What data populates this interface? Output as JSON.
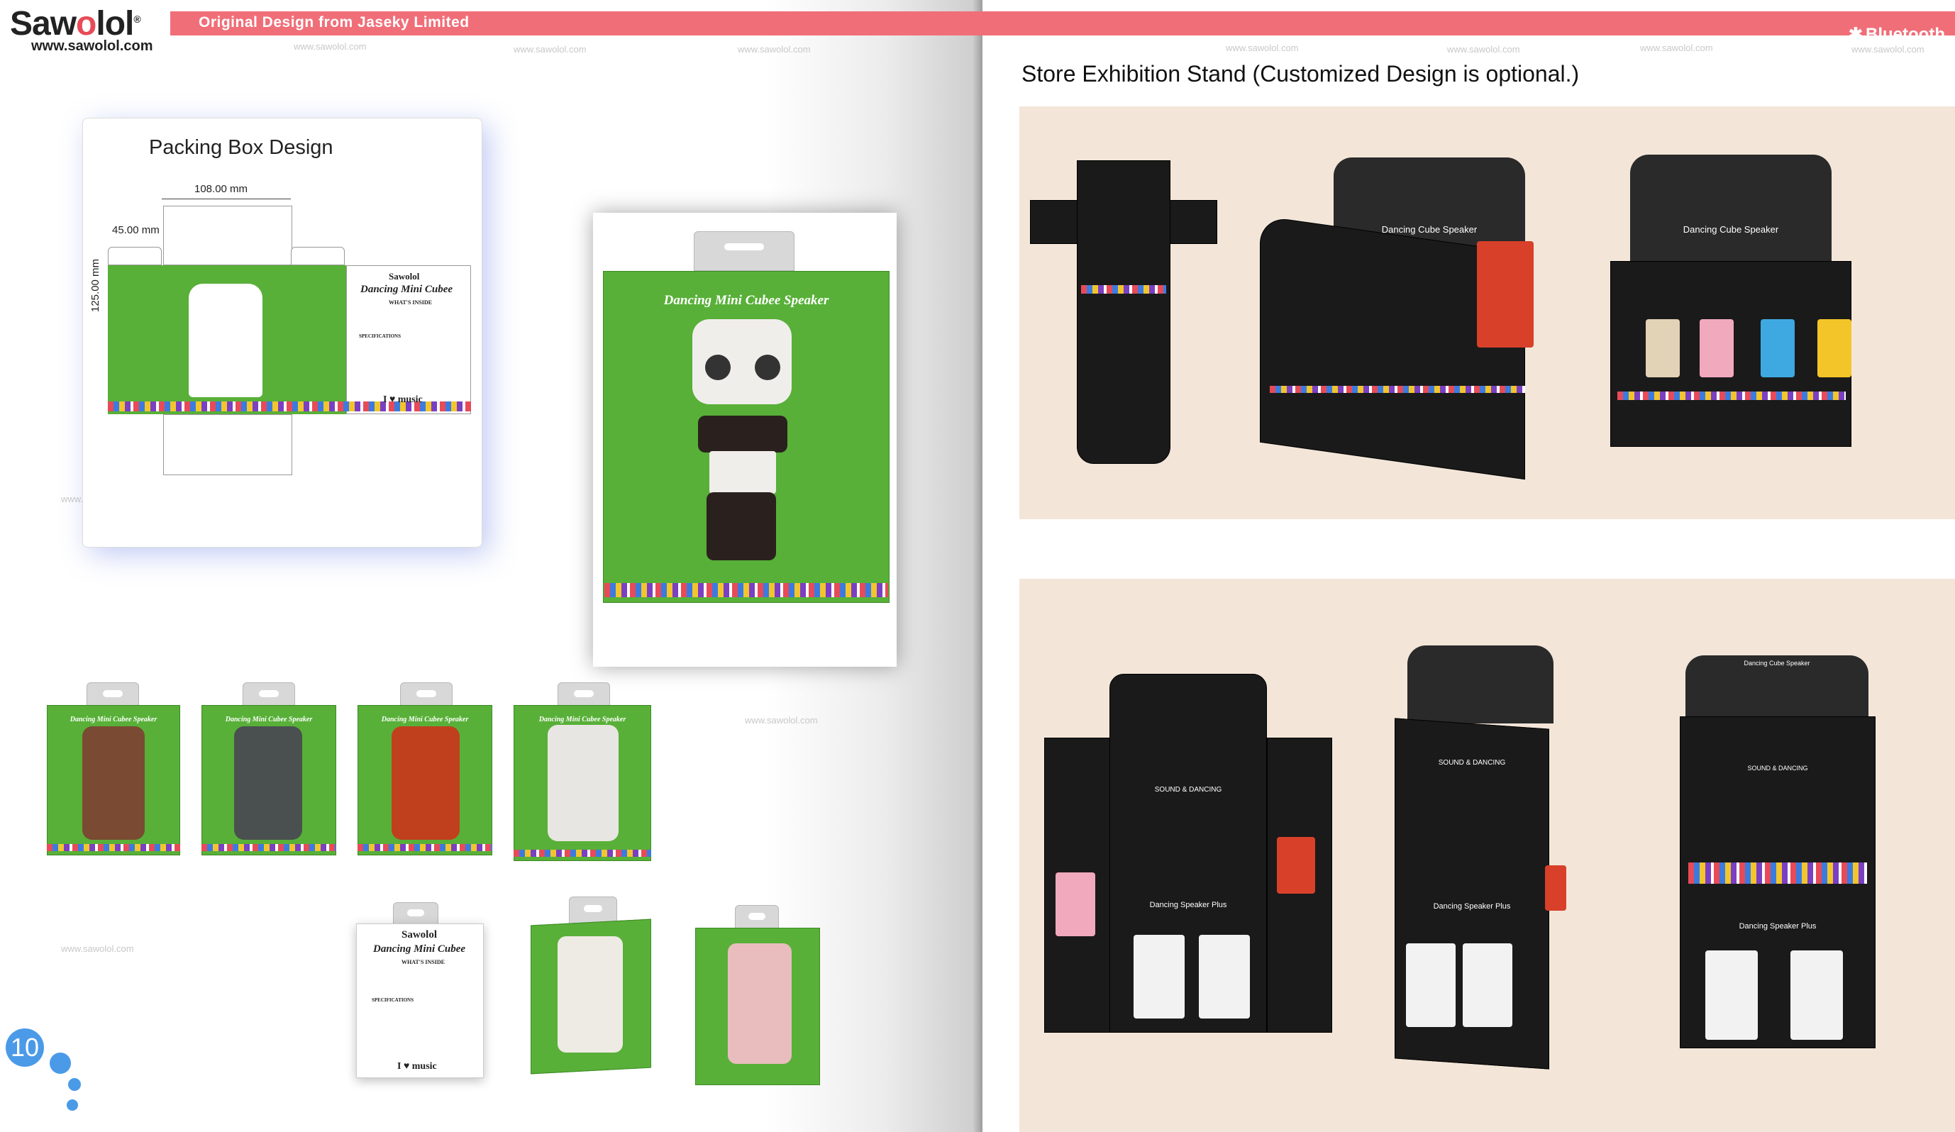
{
  "header": {
    "brand": "Sawolol",
    "url": "www.sawolol.com",
    "tagline": "Original Design from Jaseky Limited",
    "bluetooth": "Bluetooth",
    "watermark": "www.sawolol.com"
  },
  "colors": {
    "header_band": "#f06e78",
    "accent_blue": "#4a9ae8",
    "box_green": "#58b038"
  },
  "left": {
    "pack_title": "Packing Box Design",
    "dim_width": "108.00 mm",
    "dim_depth": "45.00 mm",
    "dim_height": "125.00 mm",
    "box_brand": "Sawolol",
    "box_name_front": "Dancing Mini Cubee",
    "box_name_green": "Dancing Mini Cubee Speaker",
    "whats_inside": "WHAT'S INSIDE",
    "specifications": "SPECIFICATIONS",
    "music_label": "I ♥ music",
    "page_number": "10"
  },
  "right": {
    "store_title": "Store Exhibition Stand (Customized Design is optional.)",
    "stand_label_1": "Dancing Cube Speaker",
    "stand_label_2": "Dancing Speaker Plus",
    "stand_label_3": "SOUND & DANCING"
  }
}
